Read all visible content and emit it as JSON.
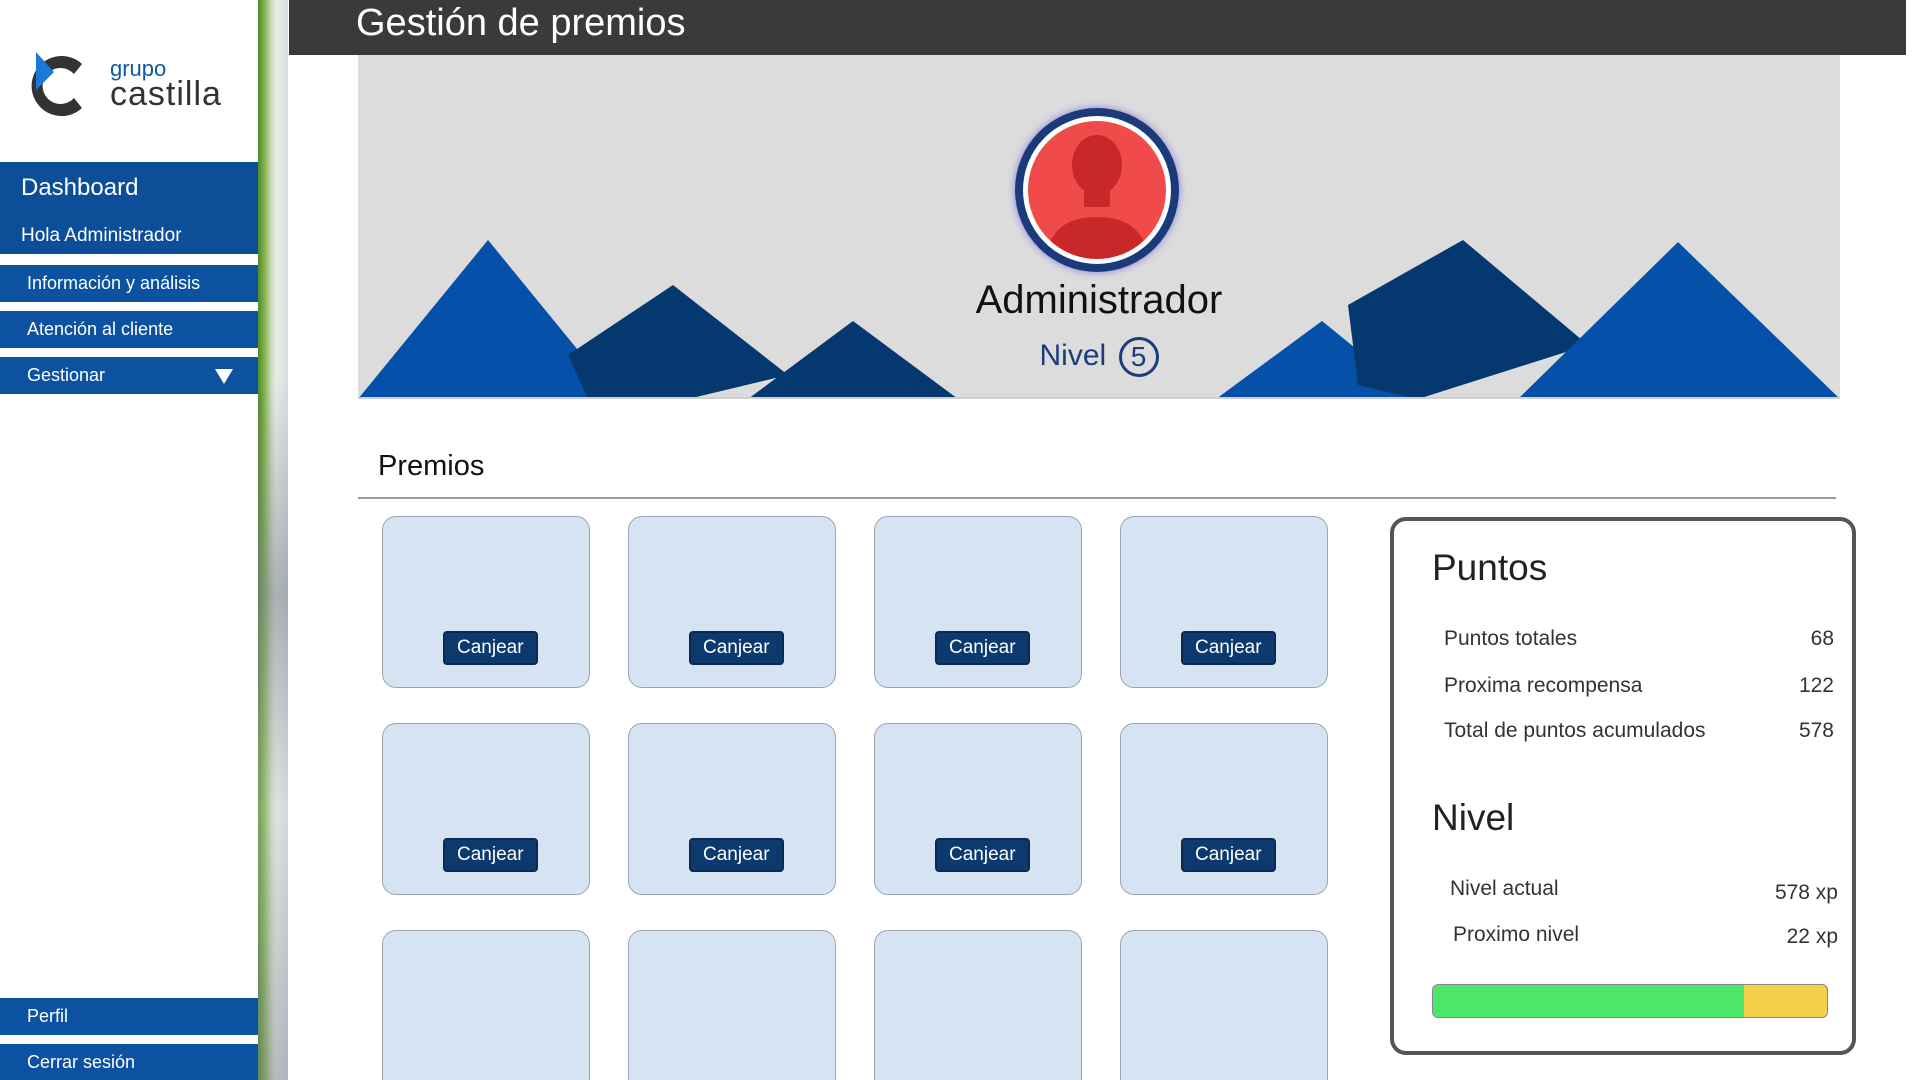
{
  "sidebar": {
    "logo": {
      "line1": "grupo",
      "line2": "castilla"
    },
    "dashboard": {
      "title": "Dashboard",
      "greeting": "Hola Administrador"
    },
    "items": [
      {
        "label": "Información y análisis"
      },
      {
        "label": "Atención al cliente"
      },
      {
        "label": "Gestionar"
      }
    ],
    "bottom_items": [
      {
        "label": "Perfil"
      },
      {
        "label": "Cerrar sesión"
      }
    ]
  },
  "header": {
    "title": "Gestión de premios"
  },
  "profile": {
    "name": "Administrador",
    "level_label": "Nivel",
    "level_value": "5"
  },
  "rewards": {
    "title": "Premios",
    "button_label": "Canjear"
  },
  "points_panel": {
    "title": "Puntos",
    "rows": [
      {
        "label": "Puntos totales",
        "value": "68"
      },
      {
        "label": "Proxima recompensa",
        "value": "122"
      },
      {
        "label": "Total de puntos acumulados",
        "value": "578"
      }
    ],
    "level_title": "Nivel",
    "level_rows": [
      {
        "label": "Nivel actual",
        "value": "578 xp"
      },
      {
        "label": "Proximo nivel",
        "value": "22 xp"
      }
    ],
    "progress_fraction": 0.79
  },
  "colors": {
    "nav_blue": "#0d52a0",
    "header_dark": "#3a3a3a",
    "mountain_blue": "#0550a8",
    "mountain_dark": "#04386e",
    "avatar_red": "#f04a4a",
    "progress_green": "#4ee76a",
    "progress_yellow": "#f5d04a"
  }
}
